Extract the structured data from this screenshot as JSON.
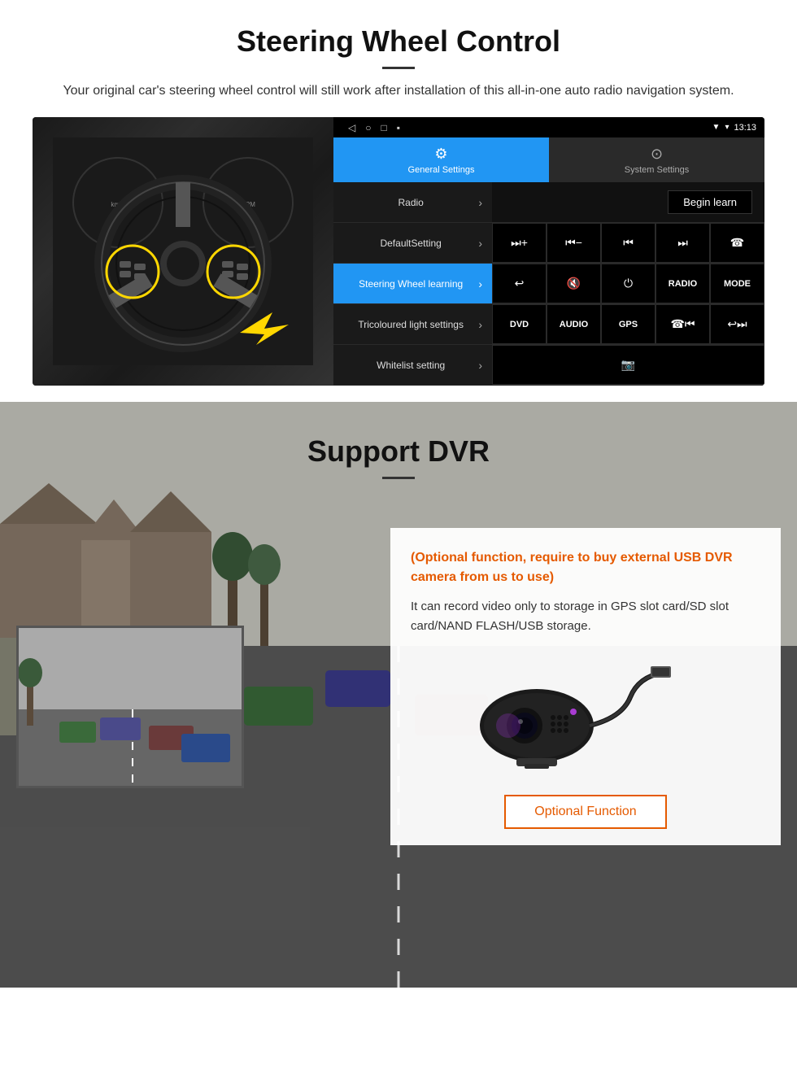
{
  "steering": {
    "title": "Steering Wheel Control",
    "subtitle": "Your original car's steering wheel control will still work after installation of this all-in-one auto radio navigation system.",
    "android": {
      "status_time": "13:13",
      "tab_general": "General Settings",
      "tab_system": "System Settings",
      "menu_items": [
        {
          "label": "Radio",
          "active": false
        },
        {
          "label": "DefaultSetting",
          "active": false
        },
        {
          "label": "Steering Wheel learning",
          "active": true
        },
        {
          "label": "Tricoloured light settings",
          "active": false
        },
        {
          "label": "Whitelist setting",
          "active": false
        }
      ],
      "begin_learn_label": "Begin learn",
      "ctrl_buttons_row1": [
        "⏭+",
        "⏮−",
        "⏮⏮",
        "⏭⏭",
        "☎"
      ],
      "ctrl_buttons_row2": [
        "↩",
        "🔇",
        "⏻",
        "RADIO",
        "MODE"
      ],
      "ctrl_buttons_row3": [
        "DVD",
        "AUDIO",
        "GPS",
        "☎⏮",
        "↩⏭⏭"
      ]
    }
  },
  "dvr": {
    "title": "Support DVR",
    "optional_text": "(Optional function, require to buy external USB DVR camera from us to use)",
    "description": "It can record video only to storage in GPS slot card/SD slot card/NAND FLASH/USB storage.",
    "optional_button_label": "Optional Function"
  }
}
